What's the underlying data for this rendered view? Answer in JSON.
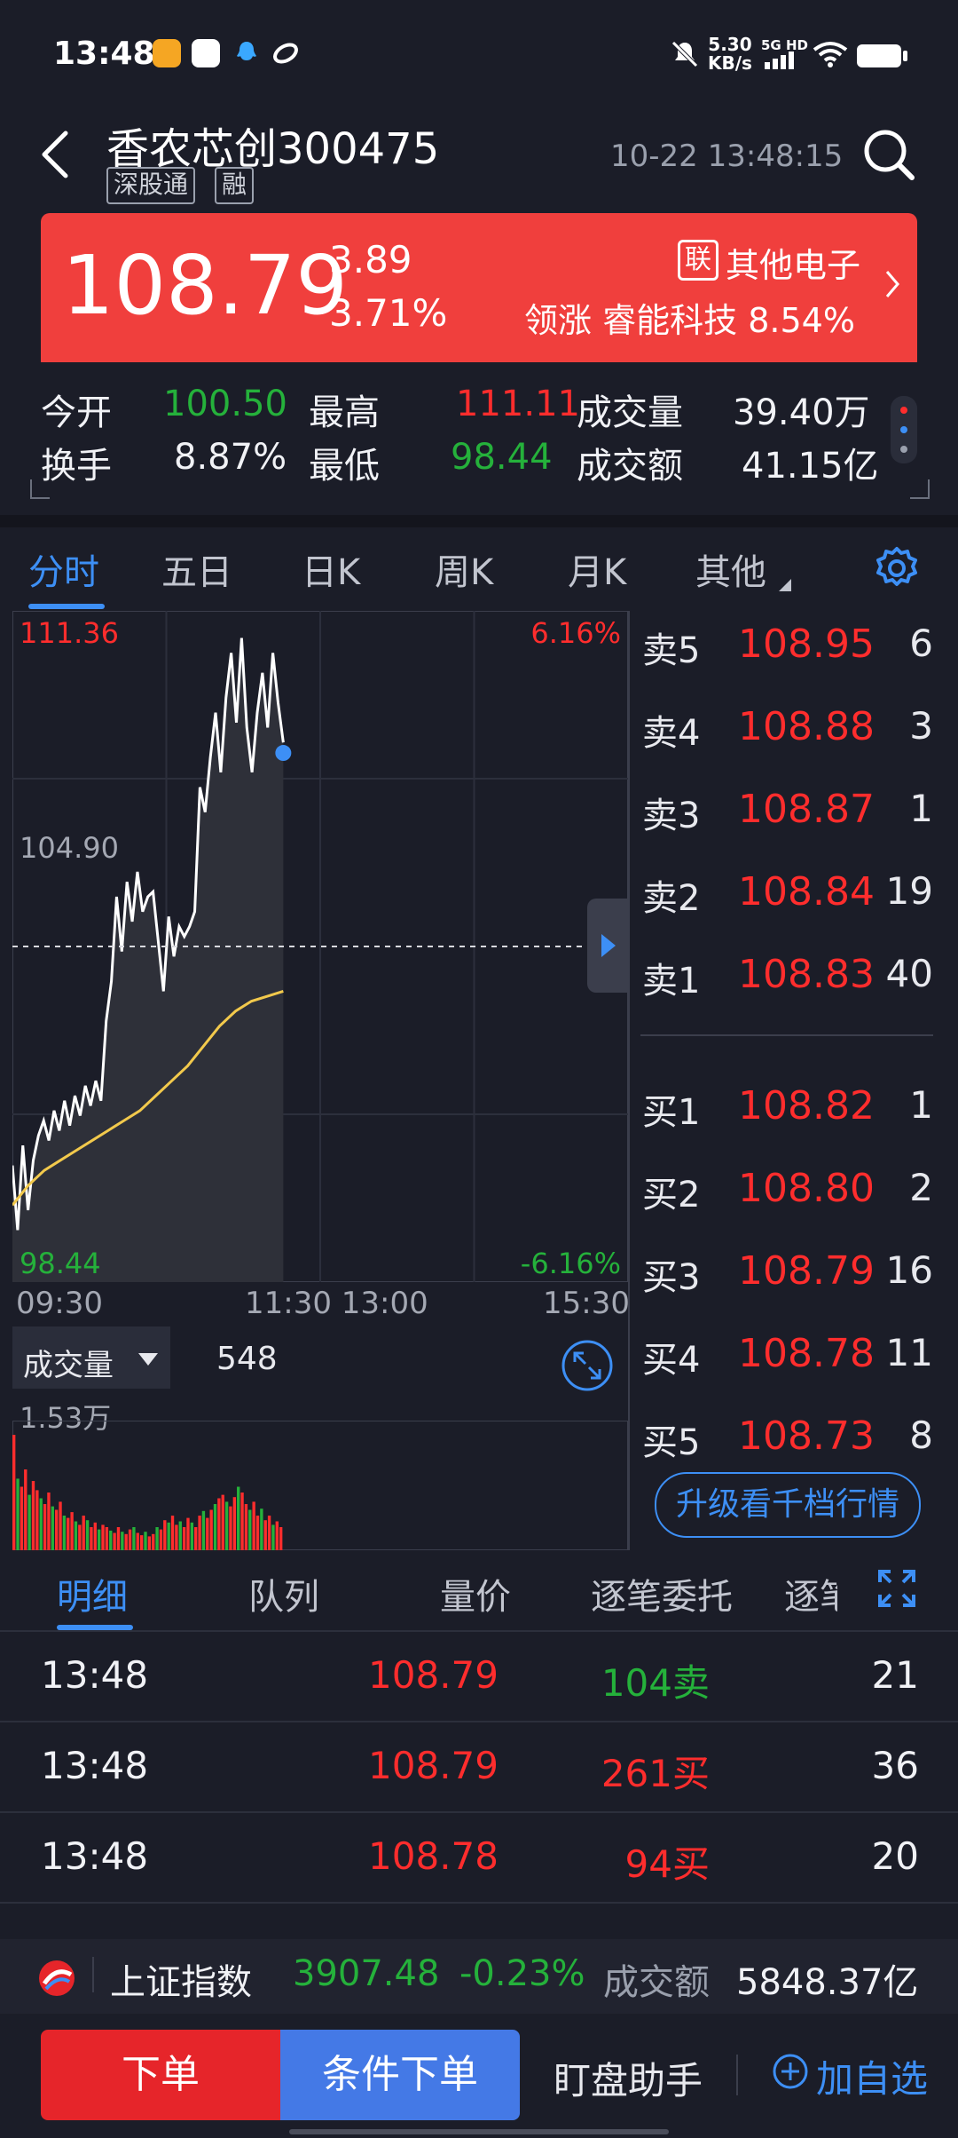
{
  "status_bar": {
    "time": "13:48",
    "network_speed_value": "5.30",
    "network_speed_unit": "KB/s",
    "network_type": "5G HD"
  },
  "header": {
    "stock_name": "香农芯创",
    "stock_code": "300475",
    "tag_connect": "深股通",
    "tag_margin": "融",
    "datetime": "10-22 13:48:15"
  },
  "quote": {
    "price": "108.79",
    "change": "3.89",
    "change_pct": "3.71%",
    "sector_tag": "联",
    "sector_name": "其他电子",
    "leader_label": "领涨",
    "leader_name": "睿能科技",
    "leader_pct": "8.54%"
  },
  "stats": {
    "open_label": "今开",
    "open": "100.50",
    "high_label": "最高",
    "high": "111.11",
    "volume_label": "成交量",
    "volume": "39.40万",
    "turnover_rate_label": "换手",
    "turnover_rate": "8.87%",
    "low_label": "最低",
    "low": "98.44",
    "amount_label": "成交额",
    "amount": "41.15亿"
  },
  "tabs": [
    "分时",
    "五日",
    "日K",
    "周K",
    "月K",
    "其他"
  ],
  "chart_data": {
    "type": "line",
    "y_top": "111.36",
    "y_mid": "104.90",
    "y_bottom": "98.44",
    "pct_top": "6.16%",
    "pct_bottom": "-6.16%",
    "ylim": [
      98.44,
      111.36
    ],
    "x_labels": [
      "09:30",
      "11:30 13:00",
      "15:30"
    ],
    "series": [
      {
        "values": [
          100.5,
          99.2,
          100.9,
          99.6,
          100.6,
          101.1,
          101.4,
          101.0,
          101.6,
          101.2,
          101.8,
          101.3,
          101.9,
          101.5,
          102.1,
          101.7,
          102.2,
          101.8,
          103.4,
          104.2,
          105.9,
          104.8,
          106.2,
          105.4,
          106.4,
          105.6,
          105.9,
          106.0,
          105.0,
          104.0,
          105.5,
          104.7,
          105.3,
          105.1,
          105.3,
          105.6,
          108.1,
          107.6,
          108.7,
          109.6,
          108.4,
          109.9,
          110.8,
          109.4,
          111.1,
          109.3,
          108.4,
          109.6,
          110.4,
          109.3,
          110.8,
          109.8,
          109.0
        ]
      },
      {
        "values": [
          99.7,
          100.1,
          100.4,
          100.6,
          100.8,
          101.0,
          101.2,
          101.4,
          101.6,
          101.9,
          102.2,
          102.5,
          102.9,
          103.3,
          103.6,
          103.8,
          103.9,
          104.0
        ]
      }
    ],
    "last_price": 108.79
  },
  "volume": {
    "label": "成交量",
    "current": "548",
    "max": "1.53万",
    "bars": [
      1.0,
      0.62,
      0.55,
      0.7,
      0.48,
      0.6,
      0.52,
      0.45,
      0.4,
      0.5,
      0.38,
      0.35,
      0.42,
      0.3,
      0.28,
      0.33,
      0.25,
      0.22,
      0.3,
      0.26,
      0.2,
      0.24,
      0.18,
      0.22,
      0.2,
      0.17,
      0.15,
      0.2,
      0.16,
      0.14,
      0.18,
      0.2,
      0.15,
      0.13,
      0.16,
      0.12,
      0.14,
      0.2,
      0.18,
      0.26,
      0.24,
      0.3,
      0.22,
      0.25,
      0.2,
      0.28,
      0.24,
      0.2,
      0.3,
      0.34,
      0.28,
      0.35,
      0.4,
      0.45,
      0.48,
      0.42,
      0.38,
      0.46,
      0.55,
      0.5,
      0.4,
      0.35,
      0.42,
      0.3,
      0.36,
      0.26,
      0.3,
      0.22,
      0.25,
      0.2
    ]
  },
  "order_book": {
    "asks": [
      {
        "label": "卖5",
        "price": "108.95",
        "qty": "6"
      },
      {
        "label": "卖4",
        "price": "108.88",
        "qty": "3"
      },
      {
        "label": "卖3",
        "price": "108.87",
        "qty": "1"
      },
      {
        "label": "卖2",
        "price": "108.84",
        "qty": "19"
      },
      {
        "label": "卖1",
        "price": "108.83",
        "qty": "40"
      }
    ],
    "bids": [
      {
        "label": "买1",
        "price": "108.82",
        "qty": "1"
      },
      {
        "label": "买2",
        "price": "108.80",
        "qty": "2"
      },
      {
        "label": "买3",
        "price": "108.79",
        "qty": "16"
      },
      {
        "label": "买4",
        "price": "108.78",
        "qty": "11"
      },
      {
        "label": "买5",
        "price": "108.73",
        "qty": "8"
      }
    ],
    "upgrade_button": "升级看千档行情"
  },
  "detail_tabs": [
    "明细",
    "队列",
    "量价",
    "逐笔委托",
    "逐笔"
  ],
  "trades": [
    {
      "time": "13:48",
      "price": "108.79",
      "amount": "104卖",
      "count": "21",
      "side": "sell"
    },
    {
      "time": "13:48",
      "price": "108.79",
      "amount": "261买",
      "count": "36",
      "side": "buy"
    },
    {
      "time": "13:48",
      "price": "108.78",
      "amount": "94买",
      "count": "20",
      "side": "buy"
    }
  ],
  "index_bar": {
    "name": "上证指数",
    "value": "3907.48",
    "change_pct": "-0.23%",
    "amount_label": "成交额",
    "amount": "5848.37亿"
  },
  "action_bar": {
    "order": "下单",
    "conditional_order": "条件下单",
    "helper": "盯盘助手",
    "add_watch": "加自选"
  },
  "colors": {
    "up": "#ff2d2d",
    "down": "#25b13b",
    "accent": "#3d8ff5",
    "banner": "#f03f3d",
    "avg_line": "#f2c94c"
  }
}
